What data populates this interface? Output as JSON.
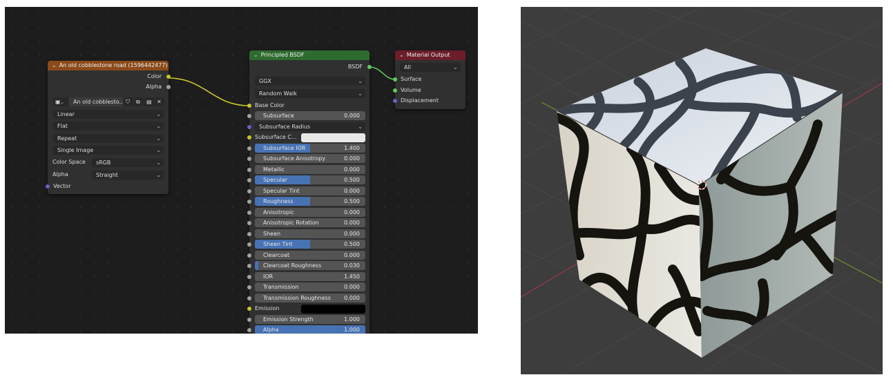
{
  "image_node": {
    "title": "An old cobblestone road (1596442477)",
    "outputs": [
      "Color",
      "Alpha"
    ],
    "image_name": "An old cobblesto...",
    "interpolation": "Linear",
    "projection": "Flat",
    "extension": "Repeat",
    "source": "Single Image",
    "color_space_label": "Color Space",
    "color_space_value": "sRGB",
    "alpha_label": "Alpha",
    "alpha_value": "Straight",
    "vector_label": "Vector",
    "header_color": "#8a4a1a"
  },
  "bsdf_node": {
    "title": "Principled BSDF",
    "output": "BSDF",
    "distribution": "GGX",
    "subsurface_method": "Random Walk",
    "base_color_label": "Base Color",
    "subsurface_radius_label": "Subsurface Radius",
    "subsurface_color_label": "Subsurface C...",
    "emission_label": "Emission",
    "header_color": "#2e6b2e",
    "fields": [
      {
        "label": "Subsurface",
        "value": "0.000",
        "fraction": 0
      },
      {
        "label": "Subsurface IOR",
        "value": "1.400",
        "fraction": 0.5
      },
      {
        "label": "Subsurface Anisotropy",
        "value": "0.000",
        "fraction": 0
      },
      {
        "label": "Metallic",
        "value": "0.000",
        "fraction": 0
      },
      {
        "label": "Specular",
        "value": "0.500",
        "fraction": 0.5
      },
      {
        "label": "Specular Tint",
        "value": "0.000",
        "fraction": 0
      },
      {
        "label": "Roughness",
        "value": "0.500",
        "fraction": 0.5
      },
      {
        "label": "Anisotropic",
        "value": "0.000",
        "fraction": 0
      },
      {
        "label": "Anisotropic Rotation",
        "value": "0.000",
        "fraction": 0
      },
      {
        "label": "Sheen",
        "value": "0.000",
        "fraction": 0
      },
      {
        "label": "Sheen Tint",
        "value": "0.500",
        "fraction": 0.5
      },
      {
        "label": "Clearcoat",
        "value": "0.000",
        "fraction": 0
      },
      {
        "label": "Clearcoat Roughness",
        "value": "0.030",
        "fraction": 0.03
      },
      {
        "label": "IOR",
        "value": "1.450",
        "fraction": 0
      },
      {
        "label": "Transmission",
        "value": "0.000",
        "fraction": 0
      },
      {
        "label": "Transmission Roughness",
        "value": "0.000",
        "fraction": 0
      },
      {
        "label": "Emission Strength",
        "value": "1.000",
        "fraction": 0
      },
      {
        "label": "Alpha",
        "value": "1.000",
        "fraction": 1
      }
    ]
  },
  "output_node": {
    "title": "Material Output",
    "target": "All",
    "inputs": [
      "Surface",
      "Volume",
      "Displacement"
    ],
    "header_color": "#6b1e2a"
  },
  "colors": {
    "socket_color": "#c7c729",
    "socket_float": "#a1a1a1",
    "socket_vector": "#6363c7",
    "socket_shader": "#63c763",
    "slider_fill": "#4772b3"
  }
}
